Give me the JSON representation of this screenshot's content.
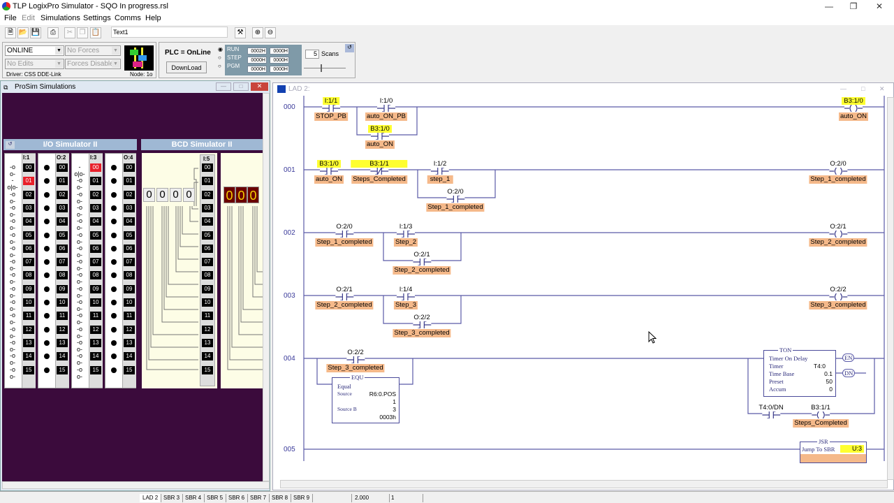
{
  "window": {
    "title": "TLP LogixPro Simulator  -  SQO In progress.rsl"
  },
  "menu": [
    "File",
    "Edit",
    "Simulations",
    "Settings",
    "Comms",
    "Help"
  ],
  "toolbar": {
    "text_field": "Text1"
  },
  "controls": {
    "mode": "ONLINE",
    "forces": "No Forces",
    "edits": "No Edits",
    "forces_enabled": "Forces Disabled",
    "driver": "Driver: CSS DDE-Link",
    "node": "Node: 1o",
    "plc_status": "PLC = OnLine",
    "download": "DownLoad",
    "run": "RUN",
    "step": "STEP",
    "pgm": "PGM",
    "hex": [
      "0002H",
      "0000H",
      "0000H",
      "0000H",
      "0000H",
      "0000H"
    ],
    "scans": "5",
    "scans_label": "Scans"
  },
  "prosim": {
    "title": "ProSim Simulations",
    "io_title": "I/O Simulator II",
    "bcd_title": "BCD Simulator II",
    "io_columns": [
      {
        "label": "I:1",
        "type": "input",
        "active": [
          1
        ]
      },
      {
        "label": "O:2",
        "type": "output",
        "active": []
      },
      {
        "label": "I:3",
        "type": "input",
        "active": [
          0
        ]
      },
      {
        "label": "O:4",
        "type": "output",
        "active": []
      }
    ],
    "rows": [
      "00",
      "01",
      "02",
      "03",
      "04",
      "05",
      "06",
      "07",
      "08",
      "09",
      "10",
      "11",
      "12",
      "13",
      "14",
      "15"
    ],
    "bcd_label": "I:5",
    "thumbwheel": [
      "0",
      "0",
      "0",
      "0"
    ],
    "display": [
      "0",
      "0",
      "0"
    ]
  },
  "ladder": {
    "title": "LAD 2:",
    "rungs": [
      "000",
      "001",
      "002",
      "003",
      "004",
      "005"
    ],
    "r0": {
      "c1": {
        "addr": "I:1/1",
        "tag": "STOP_PB"
      },
      "c2": {
        "addr": "I:1/0",
        "tag": "auto_ON_PB"
      },
      "c3": {
        "addr": "B3:1/0",
        "tag": "auto_ON"
      },
      "o": {
        "addr": "B3:1/0",
        "tag": "auto_ON"
      }
    },
    "r1": {
      "c1": {
        "addr": "B3:1/0",
        "tag": "auto_ON"
      },
      "c2": {
        "addr": "B3:1/1",
        "tag": "Steps_Completed"
      },
      "c3": {
        "addr": "I:1/2",
        "tag": "step_1"
      },
      "c4": {
        "addr": "O:2/0",
        "tag": "Step_1_completed"
      },
      "o": {
        "addr": "O:2/0",
        "tag": "Step_1_completed"
      }
    },
    "r2": {
      "c1": {
        "addr": "O:2/0",
        "tag": "Step_1_completed"
      },
      "c2": {
        "addr": "I:1/3",
        "tag": "Step_2"
      },
      "c3": {
        "addr": "O:2/1",
        "tag": "Step_2_completed"
      },
      "o": {
        "addr": "O:2/1",
        "tag": "Step_2_completed"
      }
    },
    "r3": {
      "c1": {
        "addr": "O:2/1",
        "tag": "Step_2_completed"
      },
      "c2": {
        "addr": "I:1/4",
        "tag": "Step_3"
      },
      "c3": {
        "addr": "O:2/2",
        "tag": "Step_3_completed"
      },
      "o": {
        "addr": "O:2/2",
        "tag": "Step_3_completed"
      }
    },
    "r4": {
      "c1": {
        "addr": "O:2/2",
        "tag": "Step_3_completed"
      },
      "equ": {
        "name": "EQU",
        "desc": "Equal",
        "source_label": "Source",
        "source": "R6:0.POS",
        "source_val": "1",
        "sourceb_label": "Source B",
        "sourceb": "3",
        "sourceb_val": "0003h"
      },
      "ton": {
        "name": "TON",
        "desc": "Timer On Delay",
        "timer_label": "Timer",
        "timer": "T4:0",
        "tb_label": "Time Base",
        "tb": "0.1",
        "preset_label": "Preset",
        "preset": "50",
        "accum_label": "Accum",
        "accum": "0",
        "en": "EN",
        "dn": "DN"
      },
      "c2": {
        "addr": "T4:0/DN"
      },
      "o": {
        "addr": "B3:1/1",
        "tag": "Steps_Completed"
      }
    },
    "r5": {
      "jsr": {
        "name": "JSR",
        "desc": "Jump To SBR",
        "sbr": "U:3"
      }
    }
  },
  "status": {
    "tabs": [
      "LAD 2",
      "SBR 3",
      "SBR 4",
      "SBR 5",
      "SBR 6",
      "SBR 7",
      "SBR 8",
      "SBR 9"
    ],
    "zoom": "2.000",
    "value": "1"
  }
}
